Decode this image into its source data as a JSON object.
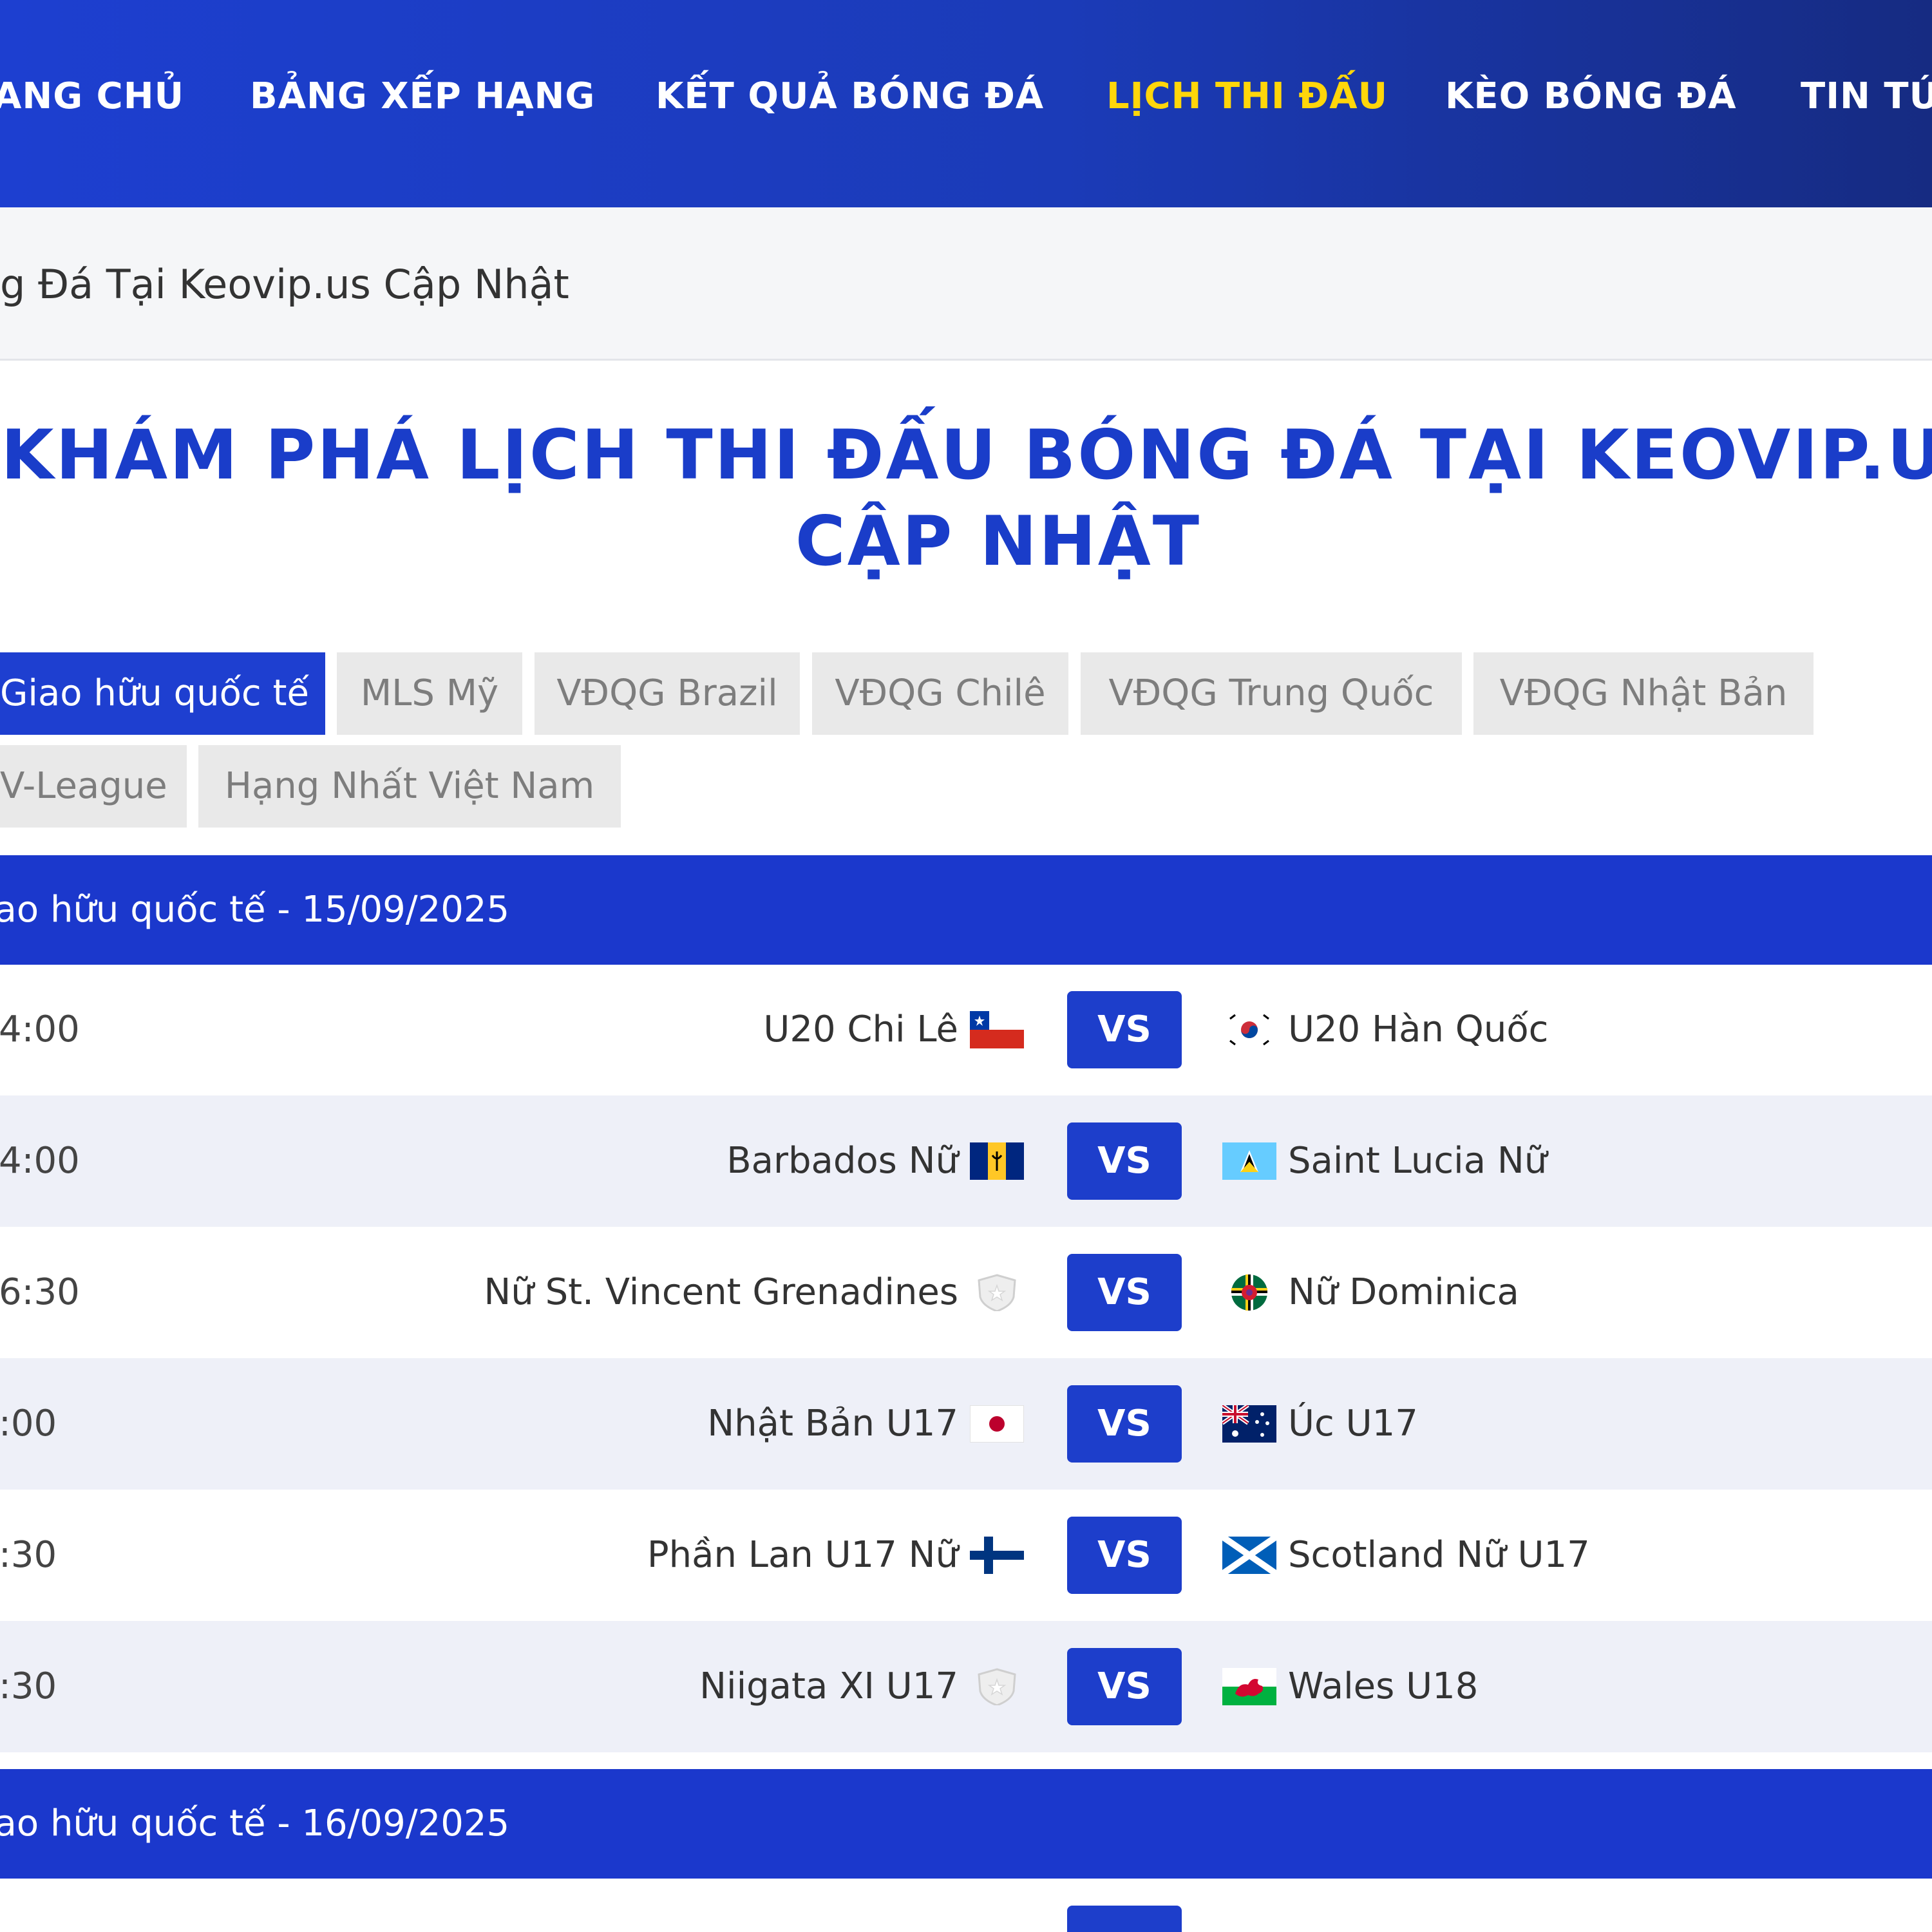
{
  "nav": {
    "items": [
      {
        "label": "ANG CHỦ",
        "active": false
      },
      {
        "label": "BẢNG XẾP HẠNG",
        "active": false
      },
      {
        "label": "KẾT QUẢ BÓNG ĐÁ",
        "active": false
      },
      {
        "label": "LỊCH THI ĐẤU",
        "active": true
      },
      {
        "label": "KÈO BÓNG ĐÁ",
        "active": false
      },
      {
        "label": "TIN TỨ",
        "active": false
      }
    ]
  },
  "breadcrumb": {
    "text": "g Đá Tại Keovip.us Cập Nhật"
  },
  "page_title": {
    "line1": "KHÁM PHÁ LỊCH THI ĐẤU BÓNG ĐÁ TẠI KEOVIP.US",
    "line2": "CẬP NHẬT"
  },
  "tabs": [
    {
      "label": "Giao hữu quốc tế",
      "active": true
    },
    {
      "label": "MLS Mỹ",
      "active": false
    },
    {
      "label": "VĐQG Brazil",
      "active": false
    },
    {
      "label": "VĐQG Chilê",
      "active": false
    },
    {
      "label": "VĐQG Trung Quốc",
      "active": false
    },
    {
      "label": "VĐQG Nhật Bản",
      "active": false
    },
    {
      "label": "V-League",
      "active": false
    },
    {
      "label": "Hạng Nhất Việt Nam",
      "active": false
    }
  ],
  "sections": [
    {
      "header": "iao hữu quốc tế - 15/09/2025",
      "matches": [
        {
          "time": "4:00",
          "home": "U20 Chi Lê",
          "home_flag": "chile-flag",
          "vs": "VS",
          "away": "U20 Hàn Quốc",
          "away_flag": "south-korea-flag"
        },
        {
          "time": "4:00",
          "home": "Barbados Nữ",
          "home_flag": "barbados-flag",
          "vs": "VS",
          "away": "Saint Lucia Nữ",
          "away_flag": "saint-lucia-flag"
        },
        {
          "time": "6:30",
          "home": "Nữ St. Vincent Grenadines",
          "home_flag": "default-shield-icon",
          "vs": "VS",
          "away": "Nữ Dominica",
          "away_flag": "dominica-flag"
        },
        {
          "time": ":00",
          "home": "Nhật Bản U17",
          "home_flag": "japan-flag",
          "vs": "VS",
          "away": "Úc U17",
          "away_flag": "australia-flag"
        },
        {
          "time": ":30",
          "home": "Phần Lan U17 Nữ",
          "home_flag": "finland-flag",
          "vs": "VS",
          "away": "Scotland Nữ U17",
          "away_flag": "scotland-flag"
        },
        {
          "time": ":30",
          "home": "Niigata XI U17",
          "home_flag": "default-shield-icon",
          "vs": "VS",
          "away": "Wales U18",
          "away_flag": "wales-flag"
        }
      ]
    },
    {
      "header": "iao hữu quốc tế - 16/09/2025",
      "matches": []
    }
  ],
  "colors": {
    "nav_gradient_start": "#1d3fd0",
    "nav_gradient_end": "#162b82",
    "nav_active": "#ffd60a",
    "primary_blue": "#1b38cc",
    "title_blue": "#1a3dc9",
    "tab_inactive_bg": "#e9e9e9",
    "row_alt_bg": "#eef0f8"
  }
}
